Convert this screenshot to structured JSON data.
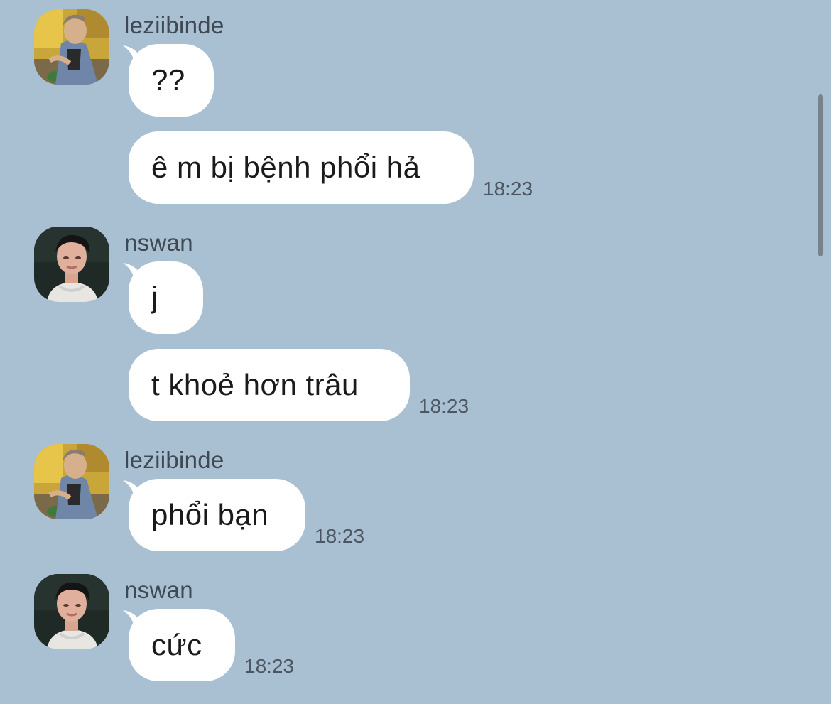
{
  "conversation": {
    "messages": [
      {
        "sender": "leziibinde",
        "text": "??",
        "time": ""
      },
      {
        "sender": "",
        "text": "ê m bị bệnh phổi hả",
        "time": "18:23"
      },
      {
        "sender": "nswan",
        "text": "j",
        "time": ""
      },
      {
        "sender": "",
        "text": "t khoẻ hơn trâu",
        "time": "18:23"
      },
      {
        "sender": "leziibinde",
        "text": "phổi bạn",
        "time": "18:23"
      },
      {
        "sender": "nswan",
        "text": "cức",
        "time": "18:23"
      }
    ]
  },
  "avatars": {
    "leziibinde": "user-avatar-photo",
    "nswan": "user-avatar-photo"
  },
  "colors": {
    "background": "#a9bfd2",
    "bubble": "#ffffff",
    "sender_name": "#3f4953",
    "timestamp": "#4c5661",
    "scrollbar": "#6f7780"
  }
}
